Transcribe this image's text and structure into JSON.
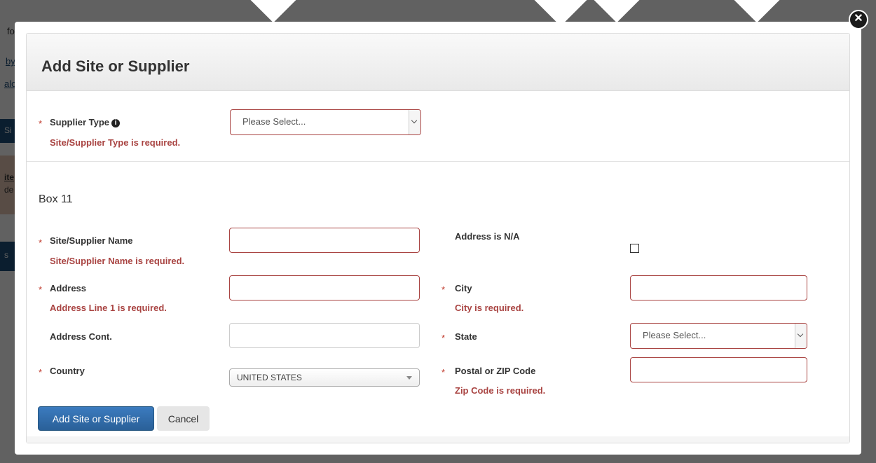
{
  "background": {
    "fragments": [
      "fo",
      "by",
      "alo",
      "Si",
      "ite",
      "de",
      "s"
    ]
  },
  "modal": {
    "title": "Add Site or Supplier",
    "close_icon": "close-icon",
    "supplier_type": {
      "required_marker": "*",
      "label": "Supplier Type",
      "info_icon": "info-icon",
      "error": "Site/Supplier Type is required.",
      "placeholder": "Please Select..."
    },
    "box_title": "Box 11",
    "fields": {
      "site_name": {
        "required_marker": "*",
        "label": "Site/Supplier Name",
        "error": "Site/Supplier Name is required.",
        "value": ""
      },
      "address_na": {
        "label": "Address is N/A",
        "checked": false
      },
      "address": {
        "required_marker": "*",
        "label": "Address",
        "error": "Address Line 1 is required.",
        "value": ""
      },
      "city": {
        "required_marker": "*",
        "label": "City",
        "error": "City is required.",
        "value": ""
      },
      "address_cont": {
        "label": "Address Cont.",
        "value": ""
      },
      "state": {
        "required_marker": "*",
        "label": "State",
        "placeholder": "Please Select..."
      },
      "country": {
        "required_marker": "*",
        "label": "Country",
        "value": "UNITED STATES"
      },
      "postal": {
        "required_marker": "*",
        "label": "Postal or ZIP Code",
        "error": "Zip Code is required.",
        "value": ""
      }
    },
    "buttons": {
      "submit": "Add Site or Supplier",
      "cancel": "Cancel"
    },
    "colors": {
      "error": "#a94442",
      "required": "#c0392b",
      "primary": "#2e6da4"
    }
  }
}
